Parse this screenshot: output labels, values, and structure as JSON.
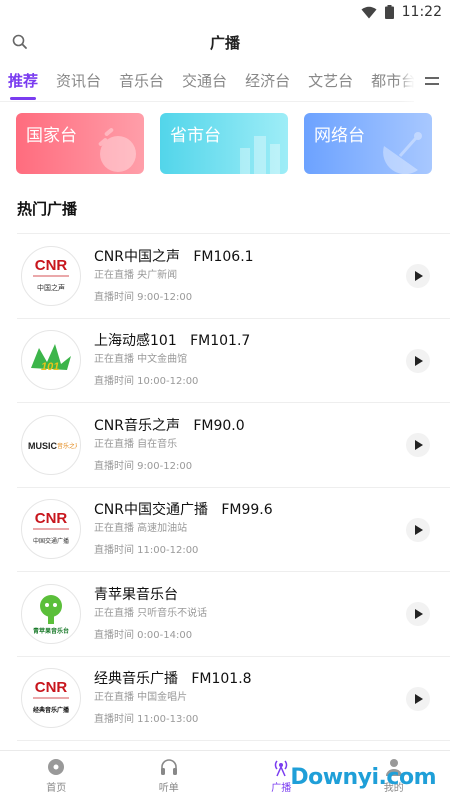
{
  "status": {
    "time": "11:22"
  },
  "header": {
    "title": "广播"
  },
  "tabs": [
    {
      "label": "推荐",
      "active": true
    },
    {
      "label": "资讯台"
    },
    {
      "label": "音乐台"
    },
    {
      "label": "交通台"
    },
    {
      "label": "经济台"
    },
    {
      "label": "文艺台"
    },
    {
      "label": "都市台"
    }
  ],
  "categories": [
    {
      "label": "国家台",
      "color": "#ff6c7e"
    },
    {
      "label": "省市台",
      "color": "#52d5ea"
    },
    {
      "label": "网络台",
      "color": "#6ca2ff"
    }
  ],
  "section": {
    "title": "热门广播"
  },
  "stations": [
    {
      "name": "CNR中国之声",
      "freq": "FM106.1",
      "playing": "正在直播 央广新闻",
      "time": "直播时间 9:00-12:00",
      "logo": "cnr",
      "logo_text": "CNR",
      "logo_sub": "中国之声"
    },
    {
      "name": "上海动感101",
      "freq": "FM101.7",
      "playing": "正在直播 中文金曲馆",
      "time": "直播时间 10:00-12:00",
      "logo": "dg",
      "logo_text": "101"
    },
    {
      "name": "CNR音乐之声",
      "freq": "FM90.0",
      "playing": "正在直播 自在音乐",
      "time": "直播时间 9:00-12:00",
      "logo": "music",
      "logo_text": "MUSIC",
      "logo_sub": "音乐之声"
    },
    {
      "name": "CNR中国交通广播",
      "freq": "FM99.6",
      "playing": "正在直播 高速加油站",
      "time": "直播时间 11:00-12:00",
      "logo": "cnr",
      "logo_text": "CNR",
      "logo_sub": "中国交通广播"
    },
    {
      "name": "青苹果音乐台",
      "freq": "",
      "playing": "正在直播 只听音乐不说话",
      "time": "直播时间 0:00-14:00",
      "logo": "apple",
      "logo_sub": "青苹果音乐台"
    },
    {
      "name": "经典音乐广播",
      "freq": "FM101.8",
      "playing": "正在直播 中国金唱片",
      "time": "直播时间 11:00-13:00",
      "logo": "cnr",
      "logo_text": "CNR",
      "logo_sub": "经典音乐广播"
    }
  ],
  "nav": [
    {
      "label": "首页",
      "icon": "disc-icon"
    },
    {
      "label": "听单",
      "icon": "headphones-icon"
    },
    {
      "label": "广播",
      "icon": "radio-tower-icon",
      "active": true
    },
    {
      "label": "我的",
      "icon": "user-icon"
    }
  ],
  "watermark": {
    "text": "Downyi.com"
  }
}
